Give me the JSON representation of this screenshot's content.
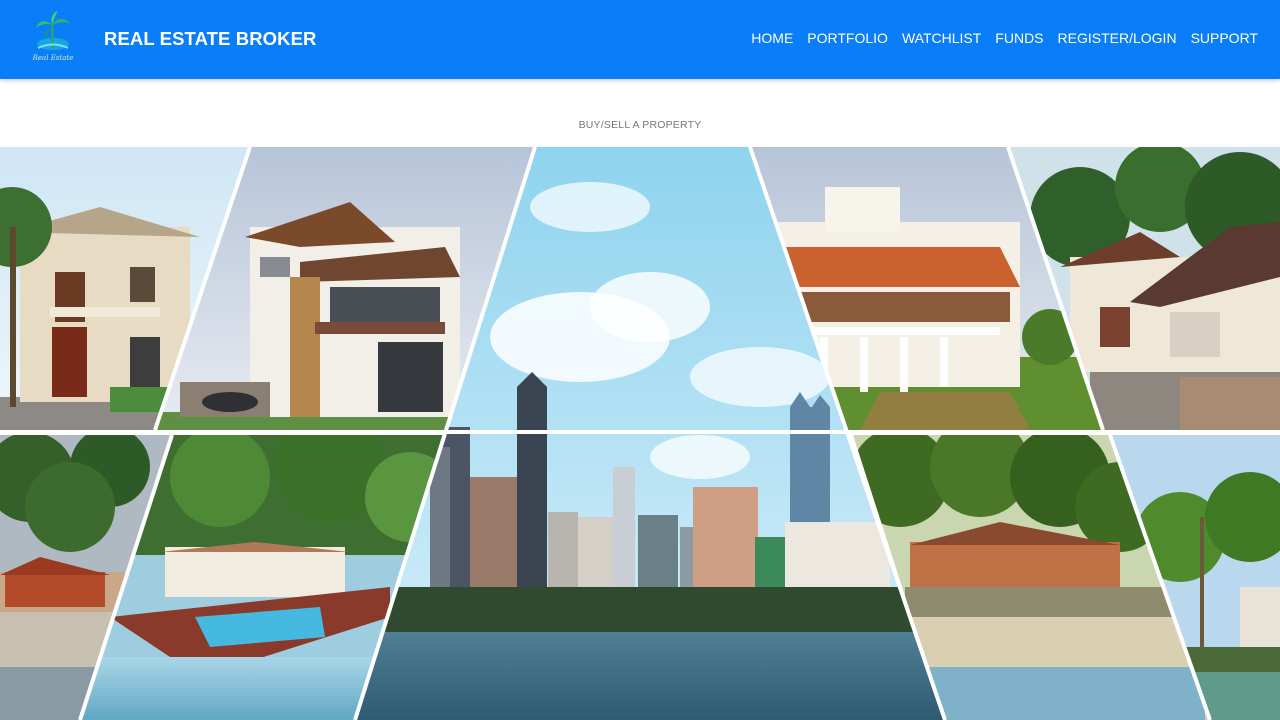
{
  "header": {
    "logo_text": "Real Estate",
    "brand": "REAL ESTATE BROKER",
    "nav": [
      {
        "label": "HOME"
      },
      {
        "label": "PORTFOLIO"
      },
      {
        "label": "WATCHLIST"
      },
      {
        "label": "FUNDS"
      },
      {
        "label": "REGISTER/LOGIN"
      },
      {
        "label": "SUPPORT"
      }
    ]
  },
  "main": {
    "subtitle": "BUY/SELL A PROPERTY",
    "collage_images": [
      "villa-photo",
      "modern-house-photo",
      "city-skyline-photo",
      "colonial-bungalow-photo",
      "tiled-roof-house-photo",
      "beach-cottage-photo",
      "resort-pool-photo",
      "palm-beach-house-photo",
      "palm-coast-photo"
    ]
  },
  "colors": {
    "navbar": "#0a7df8",
    "subtitle": "#777777"
  }
}
